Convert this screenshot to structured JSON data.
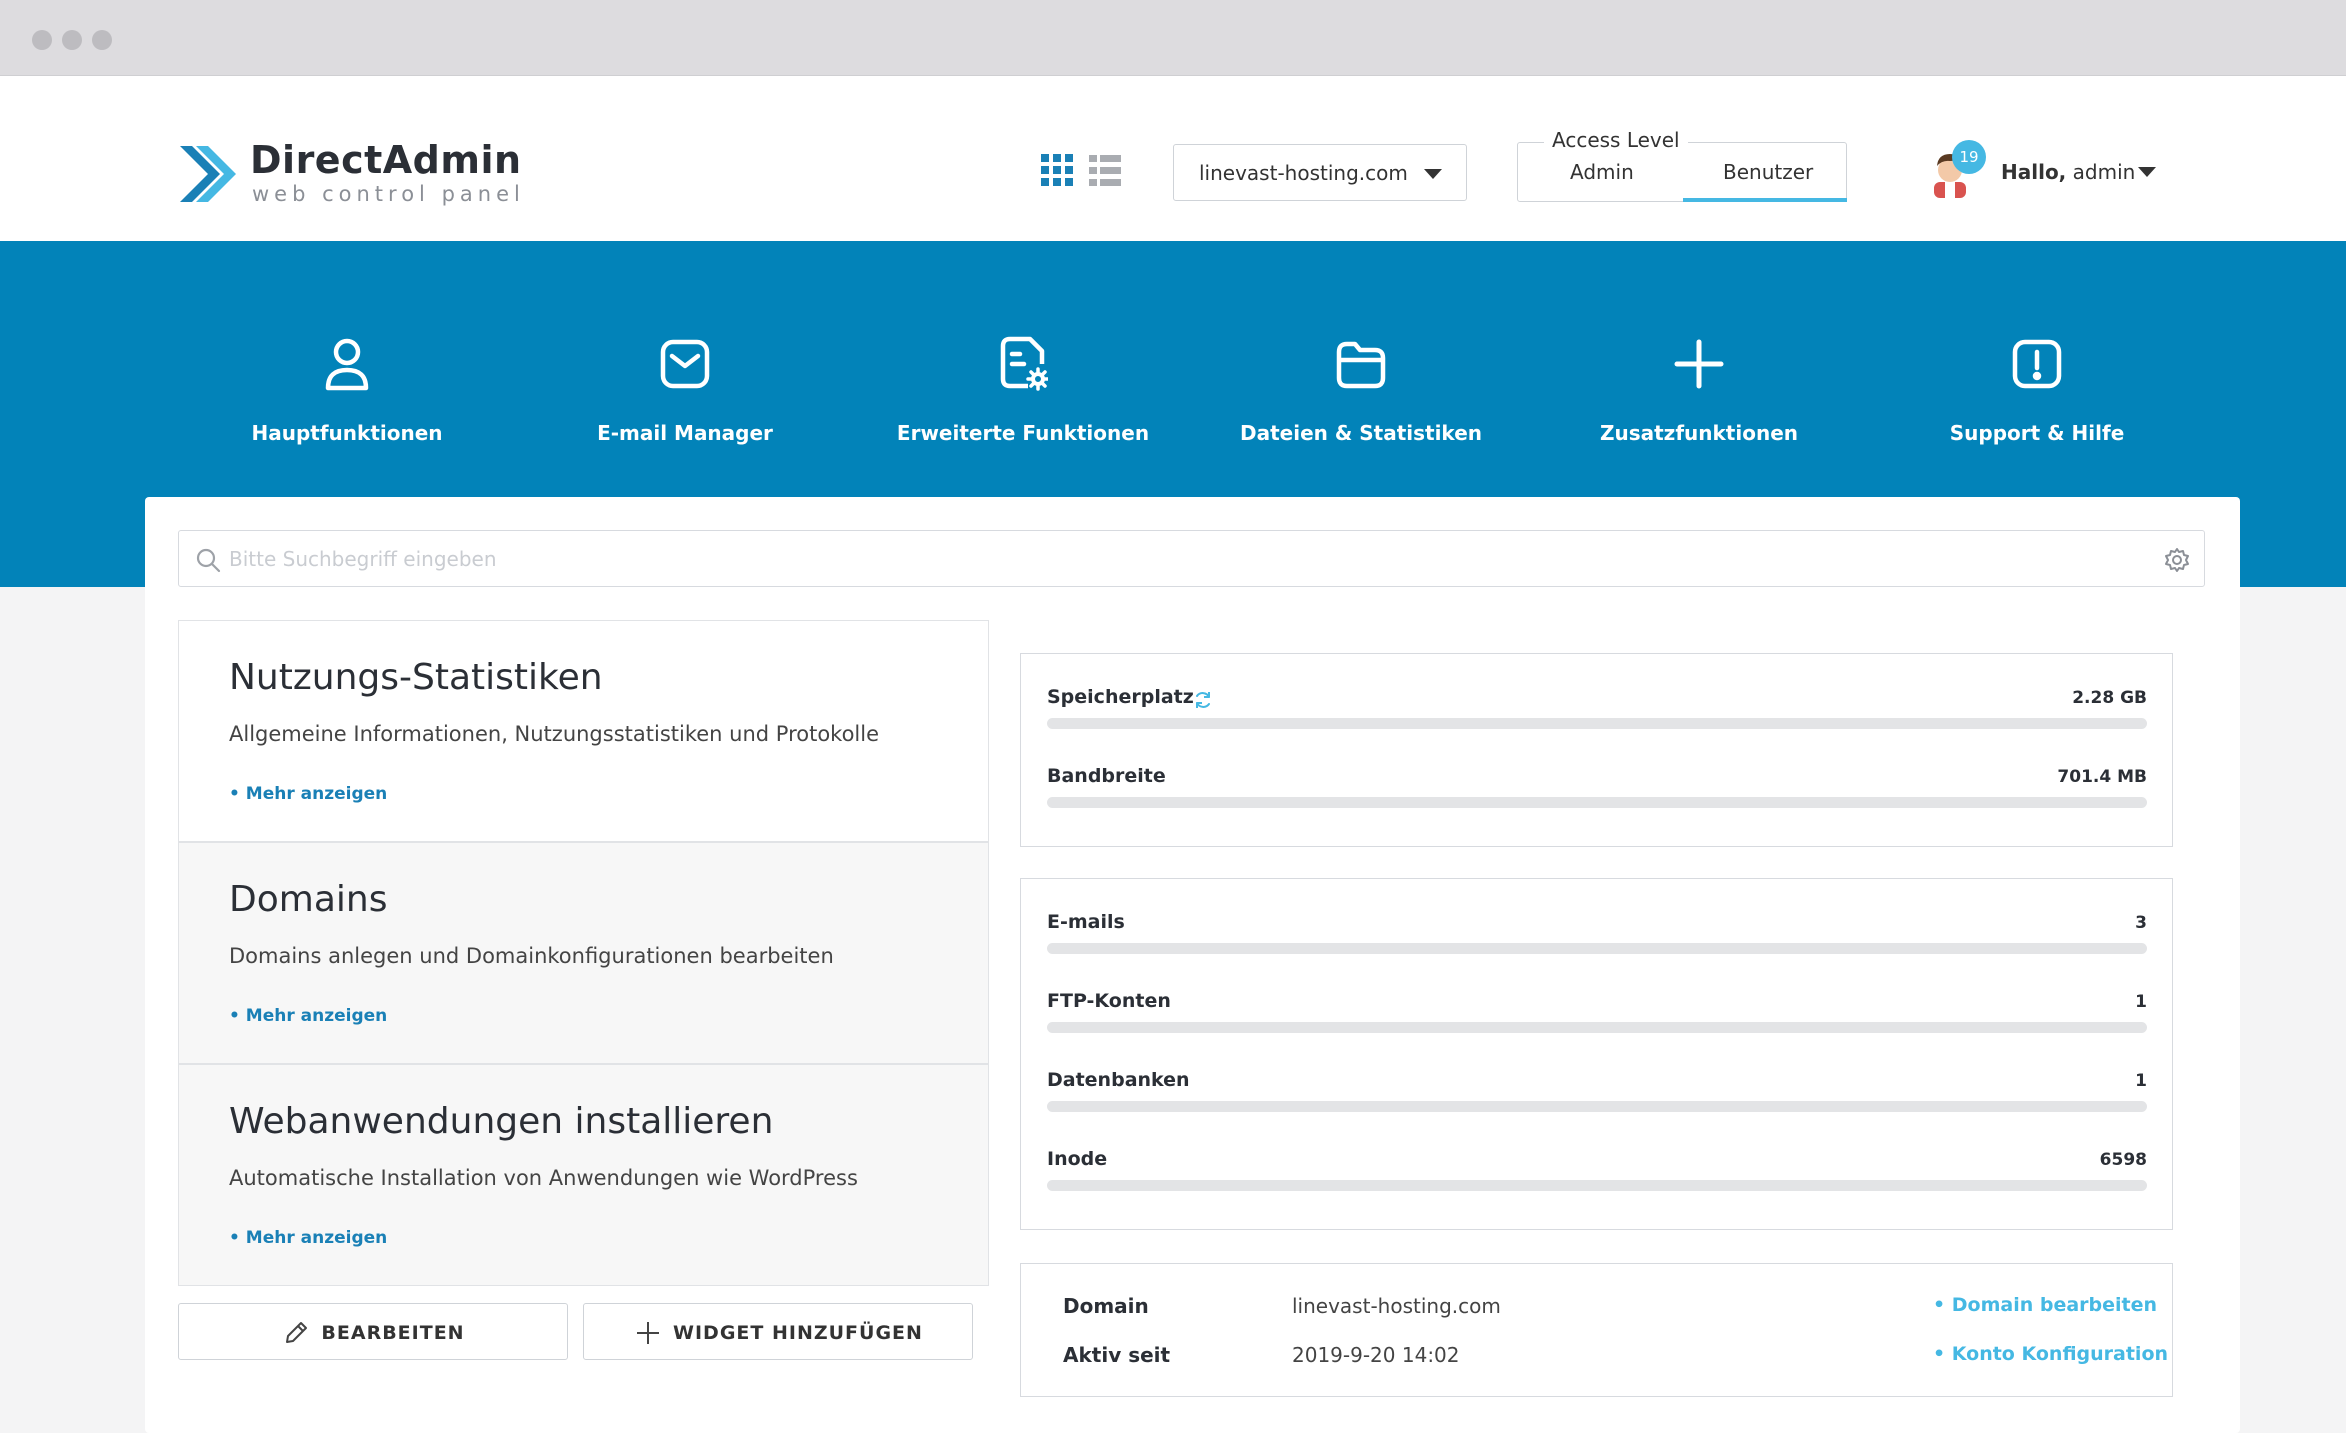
{
  "brand": {
    "name": "DirectAdmin",
    "tagline": "web control panel"
  },
  "header": {
    "domain_selected": "linevast-hosting.com",
    "access_level": {
      "legend": "Access Level",
      "options": [
        "Admin",
        "Benutzer"
      ],
      "active": "Benutzer"
    },
    "notification_count": "19",
    "greeting": "Hallo,",
    "username": "admin"
  },
  "nav": {
    "items": [
      {
        "label": "Hauptfunktionen",
        "icon": "user-icon"
      },
      {
        "label": "E-mail Manager",
        "icon": "mail-icon"
      },
      {
        "label": "Erweiterte Funktionen",
        "icon": "file-settings-icon"
      },
      {
        "label": "Dateien & Statistiken",
        "icon": "folder-icon"
      },
      {
        "label": "Zusatzfunktionen",
        "icon": "plus-icon"
      },
      {
        "label": "Support & Hilfe",
        "icon": "alert-icon"
      }
    ]
  },
  "search": {
    "placeholder": "Bitte Suchbegriff eingeben"
  },
  "widgets": [
    {
      "title": "Nutzungs-Statistiken",
      "description": "Allgemeine Informationen, Nutzungsstatistiken und Protokolle",
      "link": "• Mehr anzeigen"
    },
    {
      "title": "Domains",
      "description": "Domains anlegen und Domainkonfigurationen bearbeiten",
      "link": "• Mehr anzeigen"
    },
    {
      "title": "Webanwendungen installieren",
      "description": "Automatische Installation von Anwendungen wie WordPress",
      "link": "• Mehr anzeigen"
    }
  ],
  "actions": {
    "edit": "BEARBEITEN",
    "add_widget": "WIDGET HINZUFÜGEN"
  },
  "usage": {
    "storage": {
      "label": "Speicherplatz",
      "value": "2.28 GB",
      "fill_fraction": 0
    },
    "bandwidth": {
      "label": "Bandbreite",
      "value": "701.4 MB",
      "fill_fraction": 0
    }
  },
  "counts": [
    {
      "label": "E-mails",
      "value": "3",
      "fill_fraction": 0
    },
    {
      "label": "FTP-Konten",
      "value": "1",
      "fill_fraction": 0
    },
    {
      "label": "Datenbanken",
      "value": "1",
      "fill_fraction": 0
    },
    {
      "label": "Inode",
      "value": "6598",
      "fill_fraction": 0
    }
  ],
  "account_info": {
    "domain_label": "Domain",
    "domain_value": "linevast-hosting.com",
    "domain_action": "• Domain bearbeiten",
    "active_label": "Aktiv seit",
    "active_value": "2019-9-20 14:02",
    "active_action": "• Konto Konfiguration"
  },
  "colors": {
    "nav_background": "#0283b9",
    "accent": "#45b8e3",
    "link": "#1a80b6"
  }
}
